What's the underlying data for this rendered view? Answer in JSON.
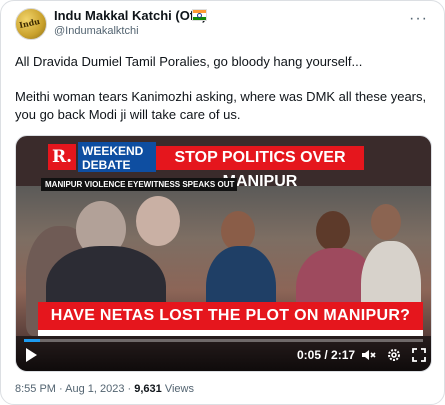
{
  "author": {
    "name": "Indu Makkal Katchi (Offl)",
    "handle": "@Indumakalktchi",
    "avatar_text": "Indu"
  },
  "tweet": {
    "line1": "All Dravida Dumiel Tamil Poralies, go bloody hang yourself...",
    "line2": "Meithi woman tears Kanimozhi asking, where was DMK all these years,",
    "line3": "you go back Modi ji will take care of us."
  },
  "video": {
    "logo": "R.",
    "weekend_label_1": "WEEKEND",
    "weekend_label_2": "DEBATE",
    "headline": "STOP POLITICS OVER MANIPUR",
    "subheadline": "MANIPUR VIOLENCE EYEWITNESS SPEAKS OUT",
    "ticker": "HAVE NETAS LOST THE PLOT ON MANIPUR?",
    "time": "0:05 / 2:17",
    "progress_fraction": 0.04
  },
  "meta": {
    "timestamp": "8:55 PM · Aug 1, 2023 · ",
    "views_count": "9,631",
    "views_label": " Views"
  },
  "colors": {
    "brand_red": "#e5161d",
    "brand_blue": "#0e4ea1",
    "secondary_text": "#536471"
  }
}
